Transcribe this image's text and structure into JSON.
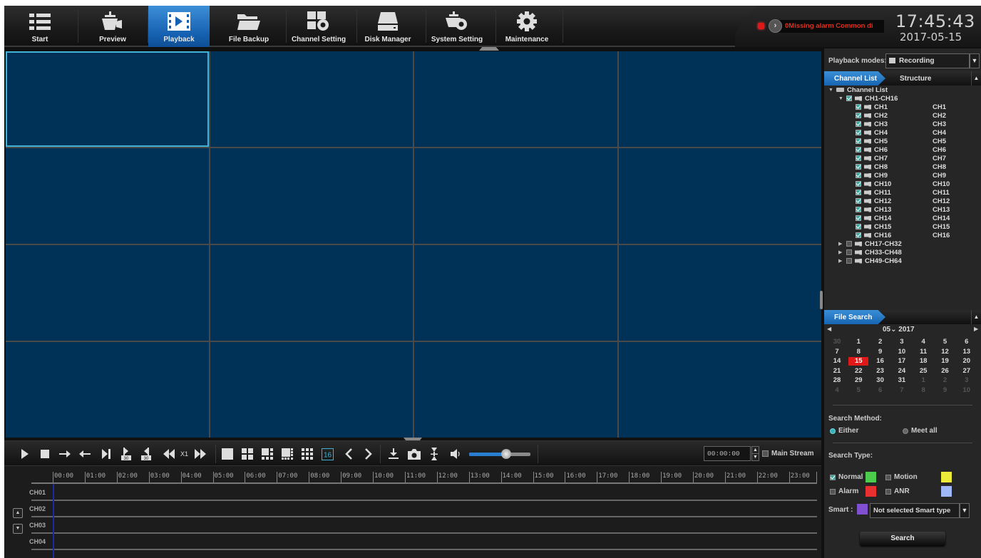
{
  "nav": {
    "items": [
      {
        "id": "start",
        "label": "Start",
        "icon": "list-icon"
      },
      {
        "id": "preview",
        "label": "Preview",
        "icon": "camera-preview-icon"
      },
      {
        "id": "playback",
        "label": "Playback",
        "icon": "film-play-icon",
        "active": true
      },
      {
        "id": "file-backup",
        "label": "File Backup",
        "icon": "folder-icon"
      },
      {
        "id": "channel-setting",
        "label": "Channel Setting",
        "icon": "channel-gear-icon"
      },
      {
        "id": "disk-manager",
        "label": "Disk Manager",
        "icon": "disk-icon"
      },
      {
        "id": "system-setting",
        "label": "System Setting",
        "icon": "camera-gear-icon"
      },
      {
        "id": "maintenance",
        "label": "Maintenance",
        "icon": "gear-icon"
      }
    ]
  },
  "status": {
    "alarm_text": "0Missing alarm   Common di",
    "time": "17:45:43",
    "date": "2017-05-15",
    "alarm_color": "#e03020"
  },
  "video_grid": {
    "rows": 4,
    "cols": 4,
    "selected_index": 0,
    "cell_color": "#003257",
    "selected_border": "#3fb3d6"
  },
  "controls": {
    "speed": "X1",
    "layout_16_label": "16",
    "skip_30_label": "30",
    "volume_percent": 60,
    "time_value": "00:00:00",
    "main_stream_label": "Main Stream",
    "main_stream_checked": false
  },
  "timeline": {
    "hours": [
      "00:00",
      "01:00",
      "02:00",
      "03:00",
      "04:00",
      "05:00",
      "06:00",
      "07:00",
      "08:00",
      "09:00",
      "10:00",
      "11:00",
      "12:00",
      "13:00",
      "14:00",
      "15:00",
      "16:00",
      "17:00",
      "18:00",
      "19:00",
      "20:00",
      "21:00",
      "22:00",
      "23:00"
    ],
    "channels": [
      "CH01",
      "CH02",
      "CH03",
      "CH04"
    ]
  },
  "sidebar": {
    "playback_modes_label": "Playback modes:",
    "playback_mode_value": "Recording",
    "tabs": {
      "channel_list": "Channel List",
      "structure": "Structure"
    },
    "tree": {
      "root": "Channel List",
      "group_open": "CH1-CH16",
      "channels": [
        {
          "name": "CH1",
          "alias": "CH1"
        },
        {
          "name": "CH2",
          "alias": "CH2"
        },
        {
          "name": "CH3",
          "alias": "CH3"
        },
        {
          "name": "CH4",
          "alias": "CH4"
        },
        {
          "name": "CH5",
          "alias": "CH5"
        },
        {
          "name": "CH6",
          "alias": "CH6"
        },
        {
          "name": "CH7",
          "alias": "CH7"
        },
        {
          "name": "CH8",
          "alias": "CH8"
        },
        {
          "name": "CH9",
          "alias": "CH9"
        },
        {
          "name": "CH10",
          "alias": "CH10"
        },
        {
          "name": "CH11",
          "alias": "CH11"
        },
        {
          "name": "CH12",
          "alias": "CH12"
        },
        {
          "name": "CH13",
          "alias": "CH13"
        },
        {
          "name": "CH14",
          "alias": "CH14"
        },
        {
          "name": "CH15",
          "alias": "CH15"
        },
        {
          "name": "CH16",
          "alias": "CH16"
        }
      ],
      "groups_closed": [
        "CH17-CH32",
        "CH33-CH48",
        "CH49-CH64"
      ]
    },
    "file_search_tab": "File Search",
    "calendar": {
      "month": "05",
      "year": "2017",
      "selected_day": "15",
      "weeks": [
        [
          {
            "d": "30",
            "m": true
          },
          {
            "d": "1"
          },
          {
            "d": "2"
          },
          {
            "d": "3"
          },
          {
            "d": "4"
          },
          {
            "d": "5"
          },
          {
            "d": "6"
          }
        ],
        [
          {
            "d": "7"
          },
          {
            "d": "8"
          },
          {
            "d": "9"
          },
          {
            "d": "10"
          },
          {
            "d": "11"
          },
          {
            "d": "12"
          },
          {
            "d": "13"
          }
        ],
        [
          {
            "d": "14"
          },
          {
            "d": "15",
            "t": true
          },
          {
            "d": "16"
          },
          {
            "d": "17"
          },
          {
            "d": "18"
          },
          {
            "d": "19"
          },
          {
            "d": "20"
          }
        ],
        [
          {
            "d": "21"
          },
          {
            "d": "22"
          },
          {
            "d": "23"
          },
          {
            "d": "24"
          },
          {
            "d": "25"
          },
          {
            "d": "26"
          },
          {
            "d": "27"
          }
        ],
        [
          {
            "d": "28"
          },
          {
            "d": "29"
          },
          {
            "d": "30"
          },
          {
            "d": "31"
          },
          {
            "d": "1",
            "m": true
          },
          {
            "d": "2",
            "m": true
          },
          {
            "d": "3",
            "m": true
          }
        ],
        [
          {
            "d": "4",
            "m": true
          },
          {
            "d": "5",
            "m": true
          },
          {
            "d": "6",
            "m": true
          },
          {
            "d": "7",
            "m": true
          },
          {
            "d": "8",
            "m": true
          },
          {
            "d": "9",
            "m": true
          },
          {
            "d": "10",
            "m": true
          }
        ]
      ]
    },
    "search_method_label": "Search Method:",
    "search_method_options": [
      "Either",
      "Meet all"
    ],
    "search_method_selected": "Either",
    "search_type_label": "Search Type:",
    "search_types": [
      {
        "label": "Normal",
        "checked": true,
        "color": "#4ccc4c"
      },
      {
        "label": "Motion",
        "checked": false,
        "color": "#eeea3a"
      },
      {
        "label": "Alarm",
        "checked": false,
        "color": "#e83030"
      },
      {
        "label": "ANR",
        "checked": false,
        "color": "#a0b8f8"
      }
    ],
    "smart_label": "Smart :",
    "smart_color": "#8050d0",
    "smart_value": "Not selected Smart type",
    "search_button": "Search"
  }
}
